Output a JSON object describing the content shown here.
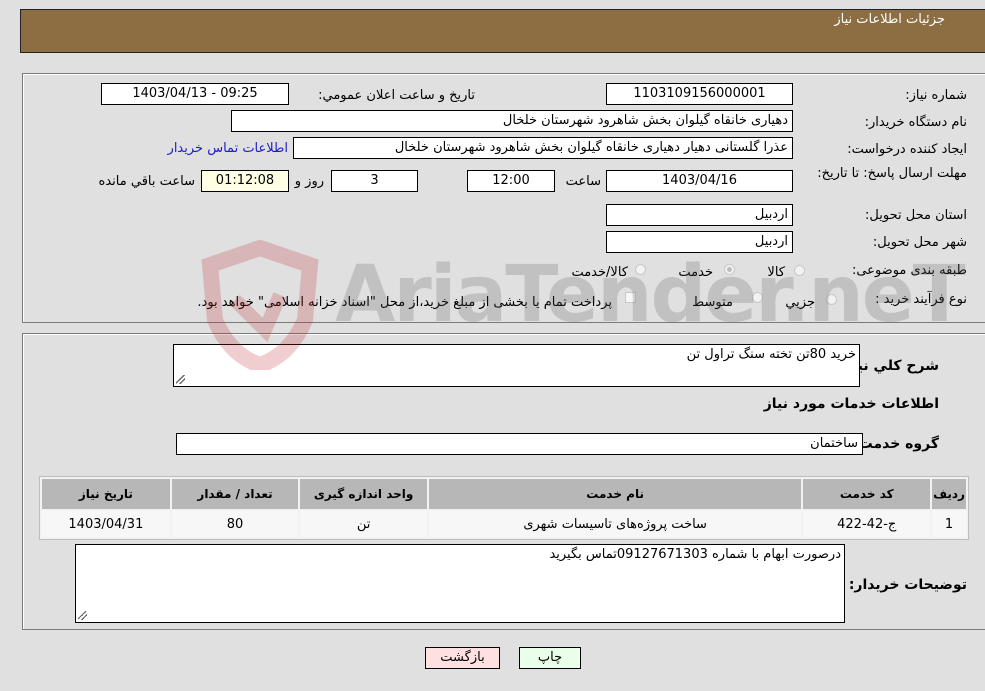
{
  "header": {
    "title": "جزئیات اطلاعات نیاز"
  },
  "details": {
    "need_number_label": "شماره نیاز:",
    "need_number": "1103109156000001",
    "announce_label": "تاریخ و ساعت اعلان عمومي:",
    "announce_value": "1403/04/13 - 09:25",
    "buyer_org_label": "نام دستگاه خریدار:",
    "buyer_org": "دهیاری خانقاه گیلوان بخش شاهرود شهرستان خلخال",
    "creator_label": "ایجاد کننده درخواست:",
    "creator": "عذرا گلستانی دهیار دهیاری خانقاه گیلوان بخش شاهرود شهرستان خلخال",
    "buyer_contact_link": "اطلاعات تماس خریدار",
    "deadline_label": "مهلت ارسال پاسخ: تا تاریخ:",
    "deadline_date": "1403/04/16",
    "time_label": "ساعت",
    "deadline_time": "12:00",
    "days": "3",
    "days_label": "روز و",
    "remaining_time": "01:12:08",
    "remaining_label": "ساعت باقي مانده",
    "province_label": "استان محل تحویل:",
    "province": "اردبیل",
    "city_label": "شهر محل تحویل:",
    "city": "اردبیل",
    "category_label": "طبقه بندی موضوعی:",
    "category_options": [
      {
        "label": "کالا",
        "checked": false
      },
      {
        "label": "خدمت",
        "checked": true
      },
      {
        "label": "کالا/خدمت",
        "checked": false
      }
    ],
    "process_label": "نوع فرآیند خرید :",
    "process_options": [
      {
        "label": "جزيي",
        "checked": false
      },
      {
        "label": "متوسط",
        "checked": false
      }
    ],
    "payment_note": "پرداخت تمام یا بخشی از مبلغ خرید،از محل \"اسناد خزانه اسلامی\" خواهد بود."
  },
  "summary": {
    "description_label": "شرح کلي نیاز:",
    "description": "خرید 80تن تخته سنگ تراول تن",
    "services_heading": "اطلاعات خدمات مورد نیاز",
    "service_group_label": "گروه خدمت:",
    "service_group": "ساختمان"
  },
  "table": {
    "headers": [
      "ردیف",
      "کد خدمت",
      "نام خدمت",
      "واحد اندازه گیری",
      "تعداد / مقدار",
      "تاریخ نیاز"
    ],
    "rows": [
      [
        "1",
        "ج-42-422",
        "ساخت پروژه‌های تاسیسات شهری",
        "تن",
        "80",
        "1403/04/31"
      ]
    ]
  },
  "buyer_notes": {
    "label": "توضیحات خریدار:",
    "text": "درصورت ابهام با شماره 09127671303تماس بگیرید"
  },
  "buttons": {
    "print": "چاپ",
    "back": "بازگشت"
  },
  "watermark": {
    "text": "AriaTender.neT"
  },
  "colors": {
    "header_bg": "#8d6e42",
    "print_bg": "#eaffea",
    "back_bg": "#ffe0e0",
    "link": "#1b1bd1"
  }
}
